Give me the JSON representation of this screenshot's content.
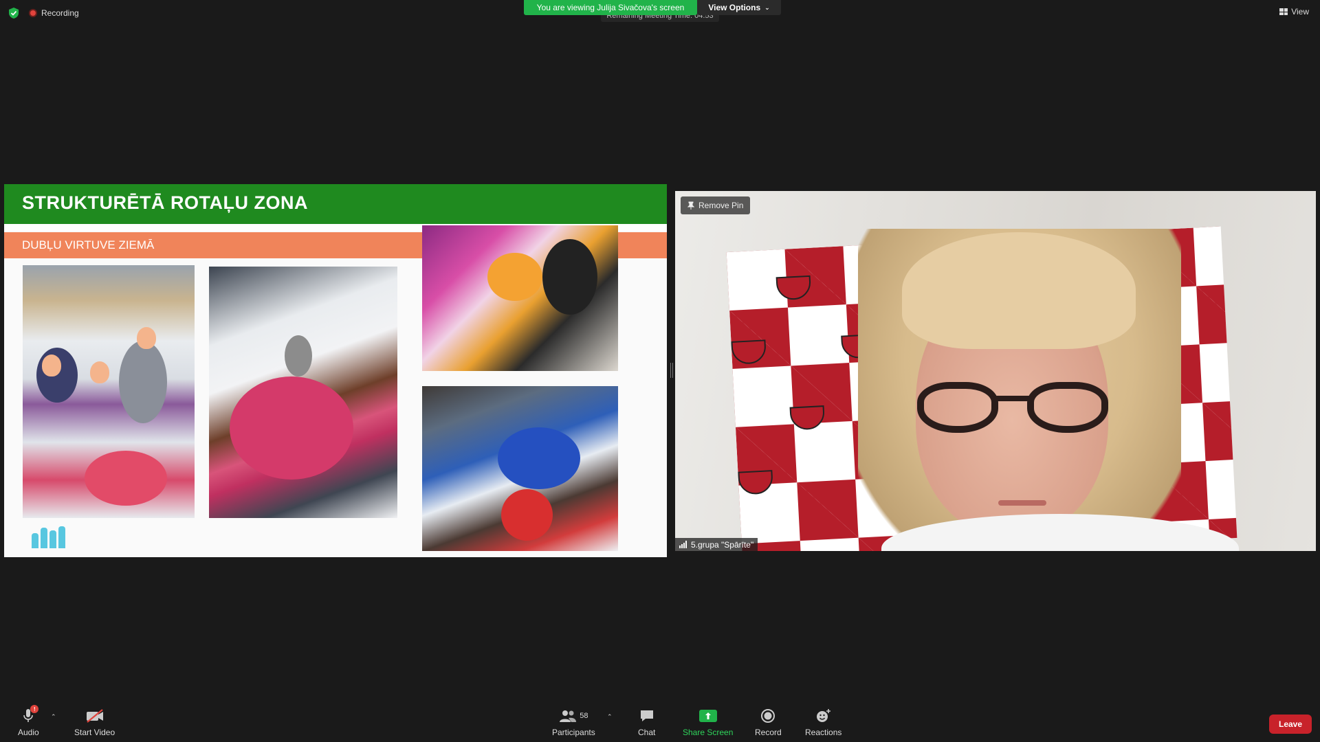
{
  "top": {
    "recording_label": "Recording",
    "viewing_banner": "You are viewing Julija Sivačova's screen",
    "view_options_label": "View Options",
    "remaining_label": "Remaining Meeting Time: 04:53",
    "view_label": "View"
  },
  "slide": {
    "title": "STRUKTURĒTĀ ROTAĻU ZONA",
    "subtitle": "DUBĻU VIRTUVE  ZIEMĀ"
  },
  "video": {
    "remove_pin_label": "Remove Pin",
    "participant_name": "5.grupa \"Spārīte\""
  },
  "toolbar": {
    "audio_label": "Audio",
    "audio_badge": "!",
    "start_video_label": "Start Video",
    "participants_label": "Participants",
    "participants_count": "58",
    "chat_label": "Chat",
    "share_screen_label": "Share Screen",
    "record_label": "Record",
    "reactions_label": "Reactions",
    "leave_label": "Leave"
  },
  "colors": {
    "accent_green": "#21b34a",
    "leave_red": "#c8222a",
    "slide_title_green": "#1f8a1f",
    "slide_subtitle_orange": "#f0845a"
  }
}
